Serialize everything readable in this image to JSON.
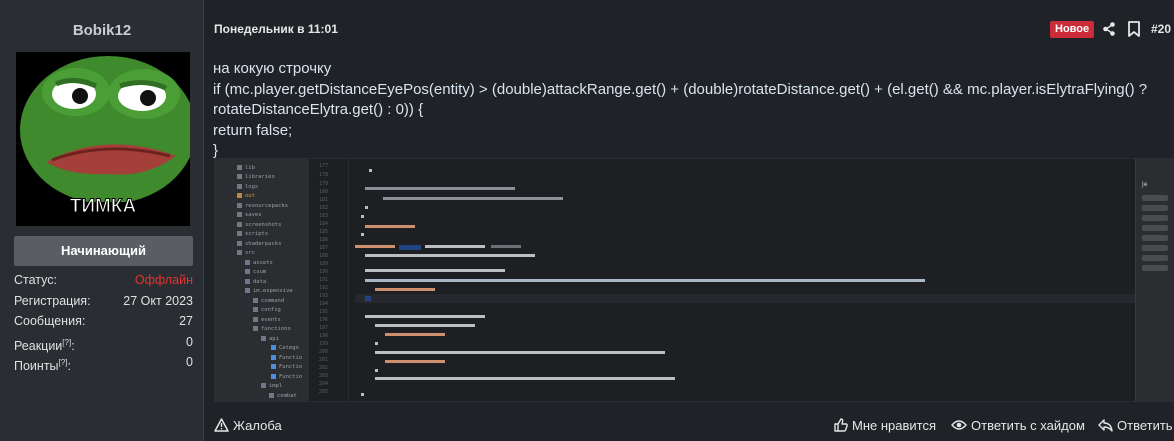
{
  "user": {
    "name": "Bobik12",
    "avatar_text": "ТИМКА",
    "rank": "Начинающий",
    "stats": [
      {
        "label": "Статус:",
        "value": "Оффлайн"
      },
      {
        "label": "Регистрация:",
        "value": "27 Окт 2023"
      },
      {
        "label": "Сообщения:",
        "value": "27"
      },
      {
        "label": "Реакции",
        "sup": "[?]",
        "colon": ":",
        "value": "0"
      },
      {
        "label": "Поинты",
        "sup": "[?]",
        "colon": ":",
        "value": "0"
      }
    ]
  },
  "post": {
    "date": "Понедельник в 11:01",
    "badge": "Новое",
    "number": "#20",
    "lines": [
      "на кокую строчку",
      "if (mc.player.getDistanceEyePos(entity) > (double)attackRange.get() + (double)rotateDistance.get() + (el.get() && mc.player.isElytraFlying() ?",
      "rotateDistanceElytra.get() : 0)) {",
      "return false;",
      "}"
    ]
  },
  "screenshot": {
    "tree": [
      "lib",
      "libraries",
      "logs",
      "out",
      "resourcepacks",
      "saves",
      "screenshots",
      "scripts",
      "shaderpacks",
      "src",
      "assets",
      "csum",
      "data",
      "im.expensive",
      "command",
      "config",
      "events",
      "functions",
      "api",
      "Catego",
      "Functio",
      "Functio",
      "Functio",
      "impl",
      "combat"
    ],
    "line_numbers": [
      "177",
      "178",
      "179",
      "180",
      "181",
      "182",
      "183",
      "184",
      "185",
      "186",
      "187",
      "188",
      "189",
      "190",
      "191",
      "192",
      "193",
      "194",
      "195",
      "196",
      "197",
      "198",
      "199",
      "200",
      "201",
      "202",
      "203",
      "204",
      "205"
    ],
    "right_label": "Je"
  },
  "footer": {
    "report": "Жалоба",
    "like": "Мне нравится",
    "reply_hide": "Ответить с хайдом",
    "reply": "Ответить"
  },
  "colors": {
    "background": "#1f2226",
    "panel": "#2a2d32",
    "badge": "#cc2b3a",
    "offline": "#e3342f",
    "message_text": "#d8e4ef"
  },
  "icons": [
    "share-icon",
    "bookmark-icon",
    "warning-icon",
    "thumbs-up-icon",
    "eye-icon",
    "reply-icon"
  ]
}
